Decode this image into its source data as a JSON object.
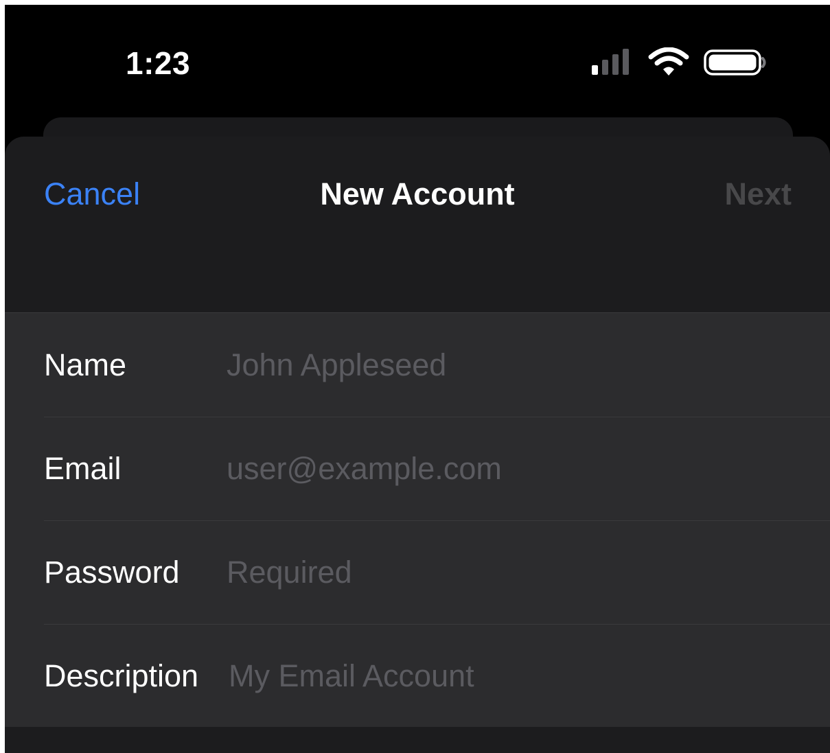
{
  "status_bar": {
    "time": "1:23",
    "icons": [
      "cellular-signal-icon",
      "wifi-icon",
      "battery-icon"
    ]
  },
  "nav": {
    "cancel_label": "Cancel",
    "title": "New Account",
    "next_label": "Next"
  },
  "form": {
    "fields": [
      {
        "label": "Name",
        "value": "",
        "placeholder": "John Appleseed"
      },
      {
        "label": "Email",
        "value": "",
        "placeholder": "user@example.com"
      },
      {
        "label": "Password",
        "value": "",
        "placeholder": "Required"
      },
      {
        "label": "Description",
        "value": "",
        "placeholder": "My Email Account"
      }
    ]
  },
  "colors": {
    "accent": "#3b82f6",
    "background": "#000000",
    "sheet": "#1c1c1e",
    "field_group": "#2c2c2e",
    "disabled_text": "#48484a",
    "placeholder_text": "#5b5b60"
  }
}
